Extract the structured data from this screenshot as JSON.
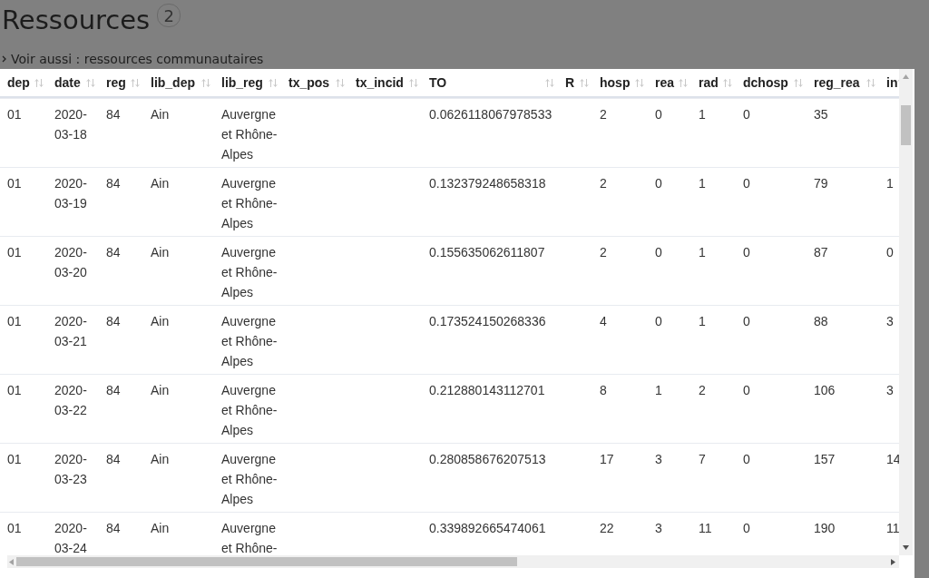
{
  "page": {
    "title": "Ressources",
    "count": "2",
    "link": "Voir aussi : ressources communautaires"
  },
  "table": {
    "columns": [
      "dep",
      "date",
      "reg",
      "lib_dep",
      "lib_reg",
      "tx_pos",
      "tx_incid",
      "TO",
      "R",
      "hosp",
      "rea",
      "rad",
      "dchosp",
      "reg_rea",
      "in"
    ],
    "rows": [
      [
        "01",
        "2020-03-18",
        "84",
        "Ain",
        "Auvergne et Rhône-Alpes",
        null,
        null,
        "0.0626118067978533",
        null,
        "2",
        "0",
        "1",
        "0",
        "35",
        null
      ],
      [
        "01",
        "2020-03-19",
        "84",
        "Ain",
        "Auvergne et Rhône-Alpes",
        null,
        null,
        "0.132379248658318",
        null,
        "2",
        "0",
        "1",
        "0",
        "79",
        "1"
      ],
      [
        "01",
        "2020-03-20",
        "84",
        "Ain",
        "Auvergne et Rhône-Alpes",
        null,
        null,
        "0.155635062611807",
        null,
        "2",
        "0",
        "1",
        "0",
        "87",
        "0"
      ],
      [
        "01",
        "2020-03-21",
        "84",
        "Ain",
        "Auvergne et Rhône-Alpes",
        null,
        null,
        "0.173524150268336",
        null,
        "4",
        "0",
        "1",
        "0",
        "88",
        "3"
      ],
      [
        "01",
        "2020-03-22",
        "84",
        "Ain",
        "Auvergne et Rhône-Alpes",
        null,
        null,
        "0.212880143112701",
        null,
        "8",
        "1",
        "2",
        "0",
        "106",
        "3"
      ],
      [
        "01",
        "2020-03-23",
        "84",
        "Ain",
        "Auvergne et Rhône-Alpes",
        null,
        null,
        "0.280858676207513",
        null,
        "17",
        "3",
        "7",
        "0",
        "157",
        "14"
      ],
      [
        "01",
        "2020-03-24",
        "84",
        "Ain",
        "Auvergne et Rhône-",
        null,
        null,
        "0.339892665474061",
        null,
        "22",
        "3",
        "11",
        "0",
        "190",
        "11"
      ]
    ]
  }
}
